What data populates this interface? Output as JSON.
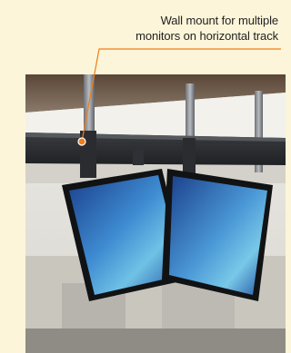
{
  "caption": {
    "line1": "Wall mount for multiple",
    "line2": "monitors on horizontal track"
  },
  "colors": {
    "page_background": "#fcf5d9",
    "callout_line": "#f07d1a",
    "caption_text": "#222222"
  },
  "icons": {
    "callout_marker": "circle-marker-icon"
  }
}
